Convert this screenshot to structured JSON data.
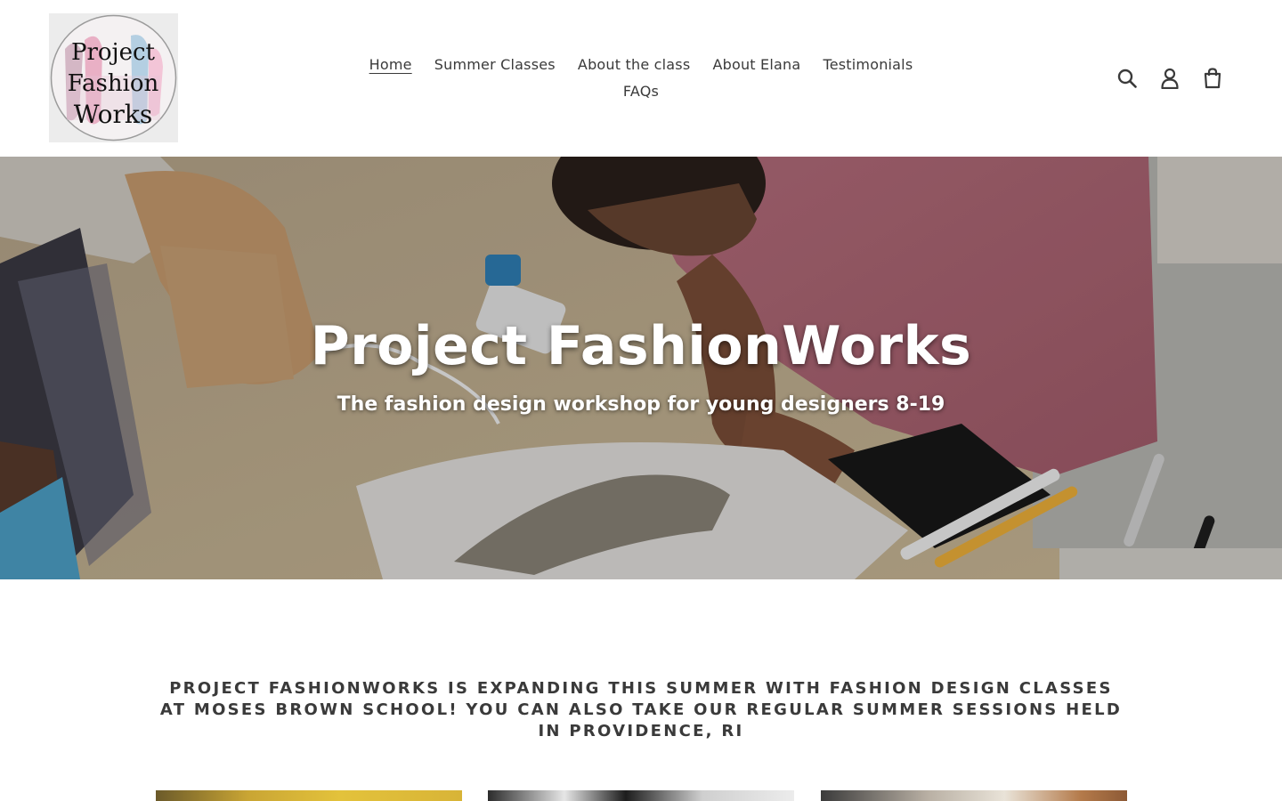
{
  "logo": {
    "lines": [
      "Project",
      "Fashion",
      "Works"
    ]
  },
  "nav": {
    "items": [
      {
        "label": "Home",
        "active": true
      },
      {
        "label": "Summer Classes",
        "active": false
      },
      {
        "label": "About the class",
        "active": false
      },
      {
        "label": "About Elana",
        "active": false
      },
      {
        "label": "Testimonials",
        "active": false
      },
      {
        "label": "FAQs",
        "active": false
      }
    ]
  },
  "header_icons": [
    "search-icon",
    "account-icon",
    "cart-icon"
  ],
  "hero": {
    "title": "Project FashionWorks",
    "subtitle": "The fashion design workshop for young designers 8-19"
  },
  "announcement": "PROJECT FASHIONWORKS IS EXPANDING THIS SUMMER WITH FASHION DESIGN CLASSES AT MOSES BROWN SCHOOL! YOU CAN ALSO TAKE OUR REGULAR SUMMER SESSIONS HELD IN PROVIDENCE, RI",
  "colors": {
    "text": "#3a3a3a",
    "background": "#ffffff",
    "hero_text": "#ffffff"
  }
}
